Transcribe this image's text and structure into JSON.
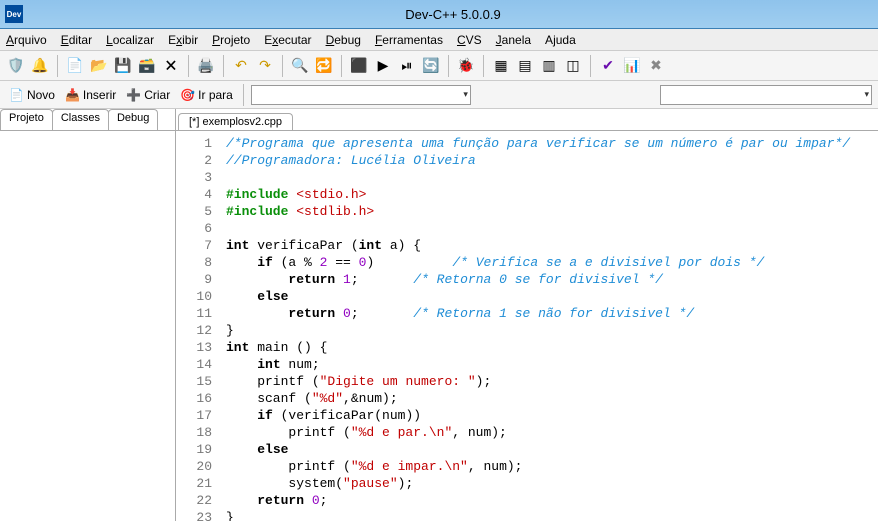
{
  "title": "Dev-C++ 5.0.0.9",
  "menu": {
    "arquivo": "Arquivo",
    "editar": "Editar",
    "localizar": "Localizar",
    "exibir": "Exibir",
    "projeto": "Projeto",
    "executar": "Executar",
    "debug": "Debug",
    "ferramentas": "Ferramentas",
    "cvs": "CVS",
    "janela": "Janela",
    "ajuda": "Ajuda"
  },
  "toolbar2": {
    "novo": "Novo",
    "inserir": "Inserir",
    "criar": "Criar",
    "irpara": "Ir para"
  },
  "tabs": {
    "projeto": "Projeto",
    "classes": "Classes",
    "debug": "Debug"
  },
  "filetab": "[*] exemplosv2.cpp",
  "lines": {
    "l1": "1",
    "l2": "2",
    "l3": "3",
    "l4": "4",
    "l5": "5",
    "l6": "6",
    "l7": "7",
    "l8": "8",
    "l9": "9",
    "l10": "10",
    "l11": "11",
    "l12": "12",
    "l13": "13",
    "l14": "14",
    "l15": "15",
    "l16": "16",
    "l17": "17",
    "l18": "18",
    "l19": "19",
    "l20": "20",
    "l21": "21",
    "l22": "22",
    "l23": "23"
  },
  "code": {
    "c1": "/*Programa que apresenta uma função para verificar se um número é par ou impar*/",
    "c2": "//Programadora: Lucélia Oliveira",
    "inc": "#include ",
    "h1": "<stdio.h>",
    "h2": "<stdlib.h>",
    "l7a": "int",
    "l7b": " verificaPar (",
    "l7c": "int",
    "l7d": " a) {",
    "l8a": "    ",
    "l8b": "if",
    "l8c": " (a % ",
    "l8n2": "2",
    "l8d": " == ",
    "l8n0": "0",
    "l8e": ")          ",
    "l8f": "/* Verifica se a e divisivel por dois */",
    "l9a": "        ",
    "l9b": "return",
    "l9c": " ",
    "l9n": "1",
    "l9d": ";       ",
    "l9e": "/* Retorna 0 se for divisivel */",
    "l10a": "    ",
    "l10b": "else",
    "l11a": "        ",
    "l11b": "return",
    "l11c": " ",
    "l11n": "0",
    "l11d": ";       ",
    "l11e": "/* Retorna 1 se não for divisivel */",
    "l12": "}",
    "l13a": "int",
    "l13b": " main () {",
    "l14a": "    ",
    "l14b": "int",
    "l14c": " num;",
    "l15a": "    printf (",
    "l15b": "\"Digite um numero: \"",
    "l15c": ");",
    "l16a": "    scanf (",
    "l16b": "\"%d\"",
    "l16c": ",&num);",
    "l17a": "    ",
    "l17b": "if",
    "l17c": " (verificaPar(num))",
    "l18a": "        printf (",
    "l18b": "\"%d e par.\\n\"",
    "l18c": ", num);",
    "l19a": "    ",
    "l19b": "else",
    "l20a": "        printf (",
    "l20b": "\"%d e impar.\\n\"",
    "l20c": ", num);",
    "l21a": "        system(",
    "l21b": "\"pause\"",
    "l21c": ");",
    "l22a": "    ",
    "l22b": "return",
    "l22c": " ",
    "l22n": "0",
    "l22d": ";",
    "l23": "}"
  }
}
